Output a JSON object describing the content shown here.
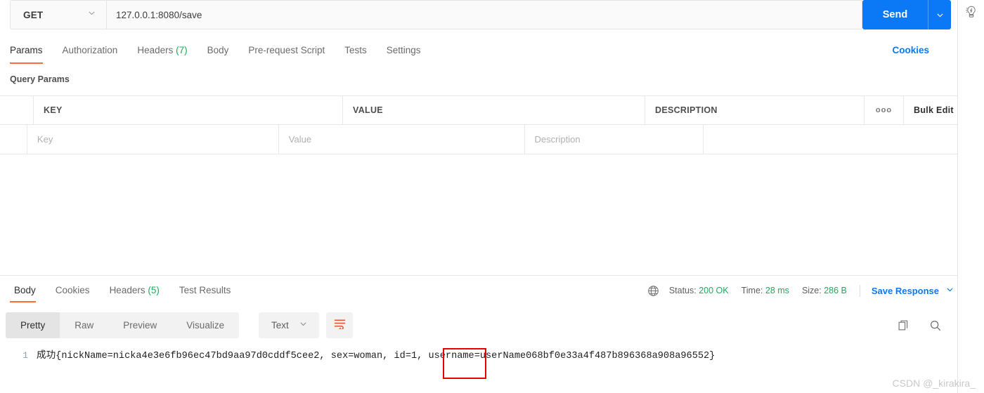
{
  "request": {
    "method": "GET",
    "method_caret_icon": "chevron-down-icon",
    "url": "127.0.0.1:8080/save",
    "send_label": "Send",
    "send_caret_icon": "chevron-down-icon",
    "tabs": [
      {
        "label": "Params",
        "count": "",
        "active": true
      },
      {
        "label": "Authorization",
        "count": "",
        "active": false
      },
      {
        "label": "Headers",
        "count": "(7)",
        "active": false
      },
      {
        "label": "Body",
        "count": "",
        "active": false
      },
      {
        "label": "Pre-request Script",
        "count": "",
        "active": false
      },
      {
        "label": "Tests",
        "count": "",
        "active": false
      },
      {
        "label": "Settings",
        "count": "",
        "active": false
      }
    ],
    "cookies_label": "Cookies"
  },
  "query_params": {
    "title": "Query Params",
    "headers": {
      "key": "KEY",
      "value": "VALUE",
      "description": "DESCRIPTION",
      "more_icon": "ooo",
      "bulk_edit": "Bulk Edit"
    },
    "rows": [
      {
        "key_placeholder": "Key",
        "value_placeholder": "Value",
        "description_placeholder": "Description"
      }
    ]
  },
  "response": {
    "tabs": [
      {
        "label": "Body",
        "count": "",
        "active": true
      },
      {
        "label": "Cookies",
        "count": "",
        "active": false
      },
      {
        "label": "Headers",
        "count": "(5)",
        "active": false
      },
      {
        "label": "Test Results",
        "count": "",
        "active": false
      }
    ],
    "globe_icon": "globe-icon",
    "status_label": "Status:",
    "status_value": "200 OK",
    "time_label": "Time:",
    "time_value": "28 ms",
    "size_label": "Size:",
    "size_value": "286 B",
    "save_response_label": "Save Response",
    "save_response_caret_icon": "chevron-down-icon",
    "view_modes": [
      {
        "label": "Pretty",
        "active": true
      },
      {
        "label": "Raw",
        "active": false
      },
      {
        "label": "Preview",
        "active": false
      },
      {
        "label": "Visualize",
        "active": false
      }
    ],
    "format": "Text",
    "format_caret_icon": "chevron-down-icon",
    "wrap_icon": "word-wrap-icon",
    "copy_icon": "copy-icon",
    "search_icon": "search-icon",
    "body": {
      "line_number": "1",
      "segment_before": "成功{nickName=nicka4e3e6fb96ec47bd9aa97d0cddf5cee2, sex=woman, ",
      "segment_highlight": "id=1, ",
      "segment_after": "username=userName068bf0e33a4f487b896368a908a96552}"
    }
  },
  "rail": {
    "bulb_icon": "lightbulb-icon"
  },
  "watermark": "CSDN @_kirakira_",
  "colors": {
    "accent_orange": "#ff6c37",
    "primary_blue": "#0b79f5",
    "success_green": "#1bab5c",
    "highlight_red": "#e60000"
  }
}
